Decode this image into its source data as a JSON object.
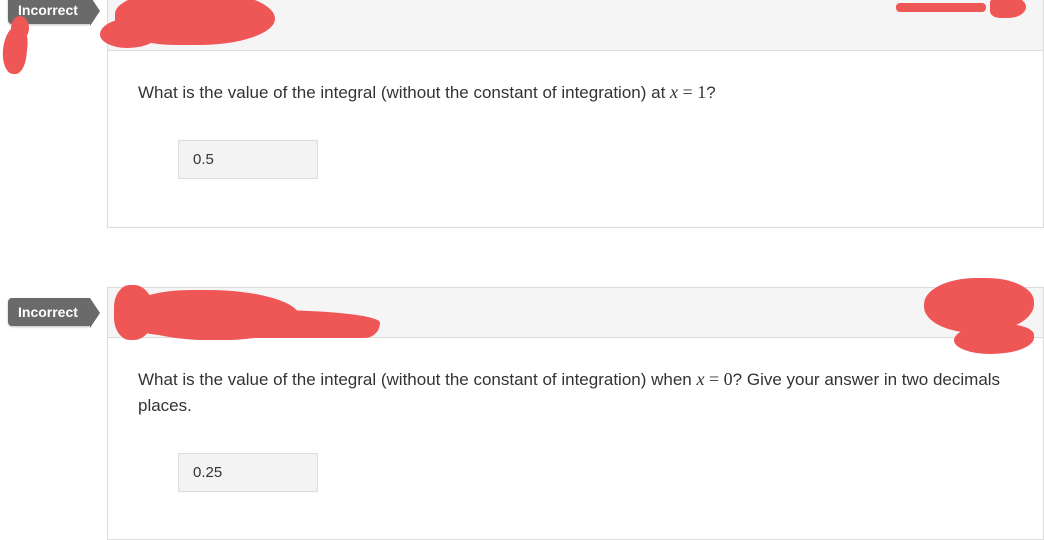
{
  "questions": [
    {
      "status": "Incorrect",
      "prompt_pre": "What is the value of the integral (without the constant of integration) at ",
      "prompt_var": "x",
      "prompt_eq": " = ",
      "prompt_val": "1",
      "prompt_post": "?",
      "prompt_extra": "",
      "answer": "0.5"
    },
    {
      "status": "Incorrect",
      "prompt_pre": "What is the value of the integral (without the constant of integration) when ",
      "prompt_var": "x",
      "prompt_eq": " = ",
      "prompt_val": "0",
      "prompt_post": "?",
      "prompt_extra": " Give your answer in two decimals places.",
      "answer": "0.25"
    }
  ]
}
